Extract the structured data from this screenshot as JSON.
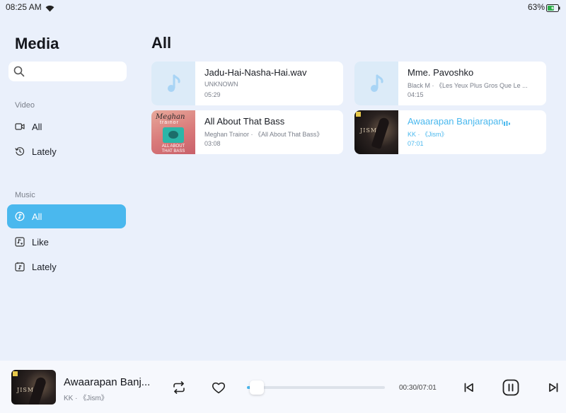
{
  "status_bar": {
    "time": "08:25 AM",
    "battery_percent": "63%",
    "battery_level": 0.63
  },
  "sidebar": {
    "title": "Media",
    "search": {
      "placeholder": "",
      "value": ""
    },
    "video_section": {
      "label": "Video",
      "items": [
        {
          "label": "All",
          "icon": "video-camera-icon"
        },
        {
          "label": "Lately",
          "icon": "history-icon"
        }
      ]
    },
    "music_section": {
      "label": "Music",
      "items": [
        {
          "label": "All",
          "icon": "music-disc-icon",
          "active": true
        },
        {
          "label": "Like",
          "icon": "liked-music-icon"
        },
        {
          "label": "Lately",
          "icon": "recent-music-icon"
        }
      ]
    }
  },
  "main": {
    "title": "All",
    "songs": [
      {
        "title": "Jadu-Hai-Nasha-Hai.wav",
        "subtitle": "UNKNOWN",
        "duration": "05:29",
        "art": "music-note-placeholder"
      },
      {
        "title": "Mme. Pavoshko",
        "subtitle": "Black M · 《Les Yeux Plus Gros Que Le ...",
        "duration": "04:15",
        "art": "music-note-placeholder"
      },
      {
        "title": "All About That Bass",
        "subtitle": "Meghan Trainor · 《All About That Bass》",
        "duration": "03:08",
        "art": "meghan-trainor-album-art",
        "art_text": [
          "Meghan",
          "trainor",
          "ALL ABOUT THAT BASS"
        ]
      },
      {
        "title": "Awaarapan Banjarapan",
        "subtitle": "KK · 《Jism》",
        "duration": "07:01",
        "art": "jism-album-art",
        "art_text": "JISM",
        "playing": true
      }
    ]
  },
  "player": {
    "title": "Awaarapan Banj...",
    "subtitle": "KK · 《Jism》",
    "current_time": "00:30",
    "total_time": "07:01",
    "time_display": "00:30/07:01",
    "progress": 0.0713,
    "art_text": "JISM"
  },
  "colors": {
    "accent": "#4ab8ee",
    "background": "#eaf0fb",
    "card": "#ffffff"
  }
}
